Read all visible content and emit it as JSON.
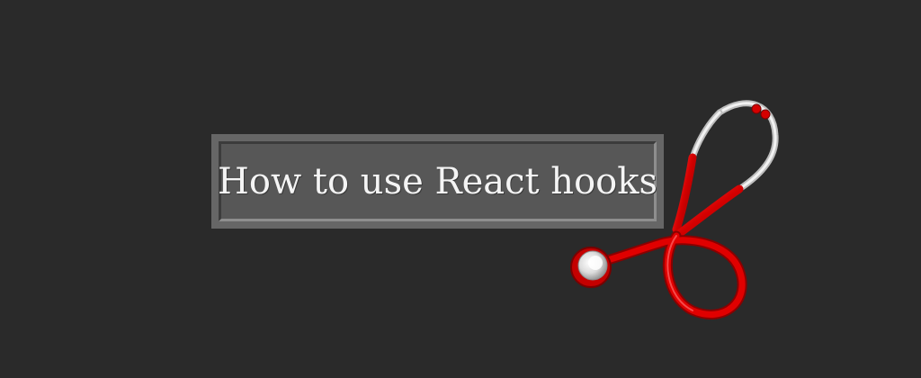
{
  "banner": {
    "title": "How to use React hooks"
  },
  "decoration": {
    "icon": "stethoscope-icon",
    "colors": {
      "background": "#2a2a2a",
      "frame": "#666666",
      "panel": "#575757",
      "tube": "#d40000",
      "earpiece": "#e6e6e6"
    }
  }
}
